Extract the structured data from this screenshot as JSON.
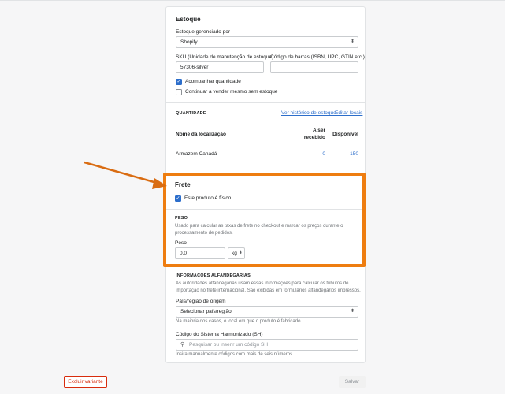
{
  "inventory": {
    "title": "Estoque",
    "managed_by_label": "Estoque gerenciado por",
    "managed_by_value": "Shopify",
    "sku_label": "SKU (Unidade de manutenção de estoque)",
    "sku_value": "57306-silver",
    "barcode_label": "Código de barras (ISBN, UPC, GTIN etc.)",
    "barcode_value": "",
    "track_quantity_label": "Acompanhar quantidade",
    "track_quantity_checked": true,
    "continue_selling_label": "Continuar a vender mesmo sem estoque",
    "continue_selling_checked": false
  },
  "quantity": {
    "caption": "QUANTIDADE",
    "history_link": "Ver histórico de estoque",
    "edit_locations_link": "Editar locais",
    "col_location": "Nome da localização",
    "col_incoming_1": "A ser",
    "col_incoming_2": "recebido",
    "col_available": "Disponível",
    "rows": [
      {
        "location": "Armazem Canadá",
        "incoming": "0",
        "available": "150"
      }
    ]
  },
  "shipping": {
    "title": "Frete",
    "physical_label": "Este produto é físico",
    "physical_checked": true,
    "weight_caption": "PESO",
    "weight_help": "Usado para calcular as taxas de frete no checkout e marcar os preços durante o processamento de pedidos.",
    "weight_label": "Peso",
    "weight_value": "0,0",
    "weight_unit": "kg"
  },
  "customs": {
    "caption": "INFORMAÇÕES ALFANDEGÁRIAS",
    "help": "As autoridades alfandegárias usam essas informações para calcular os tributos de importação no frete internacional. São exibidas em formulários alfandegários impressos.",
    "origin_label": "País/região de origem",
    "origin_value": "Selecionar país/região",
    "origin_help": "Na maioria dos casos, o local em que o produto é fabricado.",
    "hs_label": "Código do Sistema Harmonizado (SH)",
    "hs_placeholder": "Pesquisar ou inserir um código SH",
    "hs_help": "Insira manualmente códigos com mais de seis números."
  },
  "footer": {
    "delete_label": "Excluir variante",
    "save_label": "Salvar"
  },
  "colors": {
    "highlight": "#ee7d10",
    "link": "#2c6ecb",
    "danger": "#d82c0d"
  }
}
